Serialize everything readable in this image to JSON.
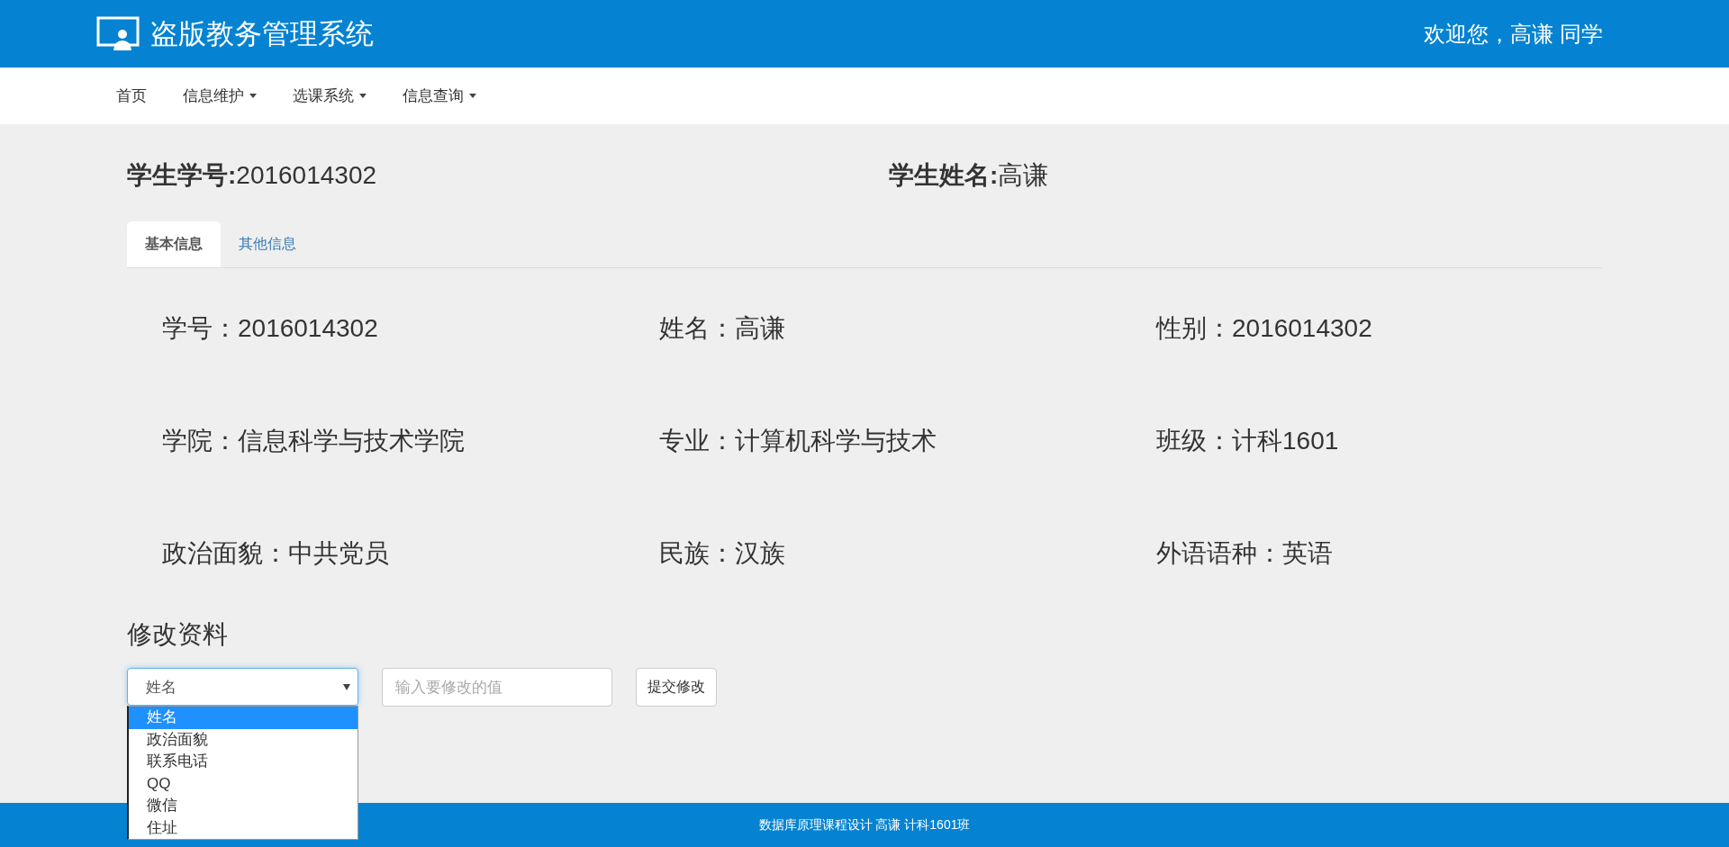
{
  "header": {
    "title": "盗版教务管理系统",
    "welcome": "欢迎您，高谦 同学"
  },
  "nav": [
    {
      "label": "首页",
      "dropdown": false
    },
    {
      "label": "信息维护",
      "dropdown": true
    },
    {
      "label": "选课系统",
      "dropdown": true
    },
    {
      "label": "信息查询",
      "dropdown": true
    }
  ],
  "summary": [
    {
      "label": "学生学号:",
      "value": "2016014302"
    },
    {
      "label": "学生姓名:",
      "value": "高谦"
    }
  ],
  "tabs": [
    {
      "label": "基本信息",
      "selected": true
    },
    {
      "label": "其他信息",
      "selected": false
    }
  ],
  "info": [
    "学号：2016014302",
    "姓名：高谦",
    "性别：2016014302",
    "学院：信息科学与技术学院",
    "专业：计算机科学与技术",
    "班级：计科1601",
    "政治面貌：中共党员",
    "民族：汉族",
    "外语语种：英语"
  ],
  "edit": {
    "title": "修改资料",
    "select": {
      "value": "姓名",
      "expanded": true,
      "options": [
        {
          "label": "姓名",
          "selected": true
        },
        {
          "label": "政治面貌",
          "selected": false
        },
        {
          "label": "联系电话",
          "selected": false
        },
        {
          "label": "QQ",
          "selected": false
        },
        {
          "label": "微信",
          "selected": false
        },
        {
          "label": "住址",
          "selected": false
        }
      ]
    },
    "input": {
      "placeholder": "输入要修改的值"
    },
    "submit": "提交修改"
  },
  "footer": "数据库原理课程设计 高谦 计科1601班"
}
